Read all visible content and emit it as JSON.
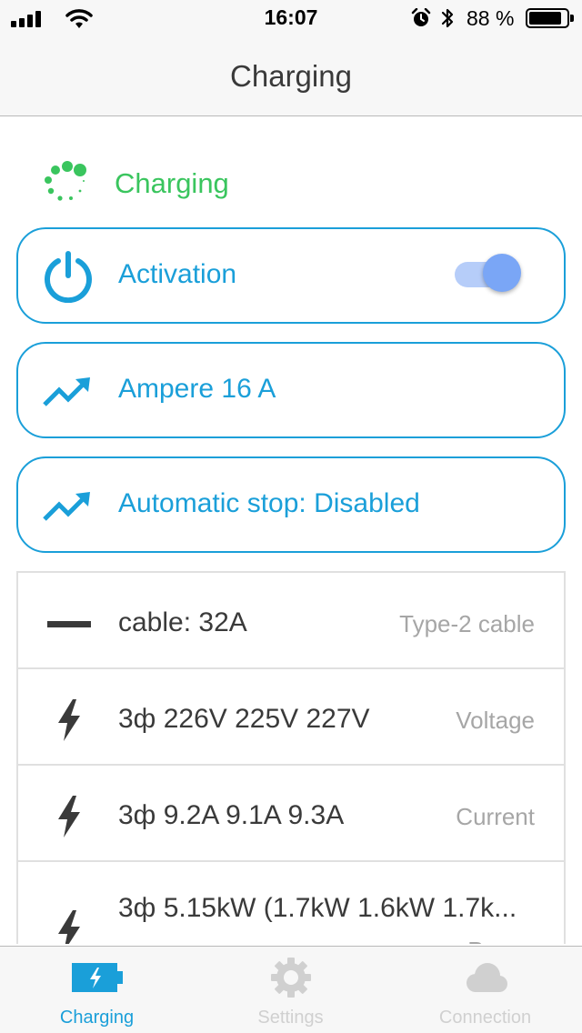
{
  "status_bar": {
    "time": "16:07",
    "battery_percent_text": "88 %",
    "battery_level": 0.88,
    "icons": [
      "signal-bars-icon",
      "wifi-icon",
      "alarm-clock-icon",
      "bluetooth-icon",
      "battery-icon"
    ]
  },
  "nav": {
    "title": "Charging"
  },
  "charging_status": {
    "label": "Charging",
    "icon": "loading-spinner-icon",
    "color": "#3ac55e"
  },
  "cards": [
    {
      "label": "Activation",
      "icon": "power-icon",
      "toggle_on": true
    },
    {
      "label": "Ampere 16 A",
      "icon": "trend-up-icon"
    },
    {
      "label": "Automatic stop: Disabled",
      "icon": "trend-up-icon"
    }
  ],
  "info_rows": [
    {
      "icon": "cable-icon",
      "value": "cable: 32A",
      "caption": "Type-2 cable"
    },
    {
      "icon": "lightning-icon",
      "value": "3ф 226V 225V 227V",
      "caption": "Voltage"
    },
    {
      "icon": "lightning-icon",
      "value": "3ф 9.2A 9.1A 9.3A",
      "caption": "Current"
    },
    {
      "icon": "lightning-icon",
      "value": "3ф 5.15kW (1.7kW 1.6kW 1.7k...",
      "caption": "Power"
    }
  ],
  "tabs": [
    {
      "label": "Charging",
      "icon": "battery-charging-icon",
      "active": true
    },
    {
      "label": "Settings",
      "icon": "gear-icon",
      "active": false
    },
    {
      "label": "Connection",
      "icon": "cloud-icon",
      "active": false
    }
  ],
  "colors": {
    "accent": "#1a9fd9",
    "status_green": "#3ac55e",
    "toggle_thumb": "#7aa6f6",
    "toggle_track": "#b6cdf9",
    "inactive_tab": "#d0d0d0"
  }
}
